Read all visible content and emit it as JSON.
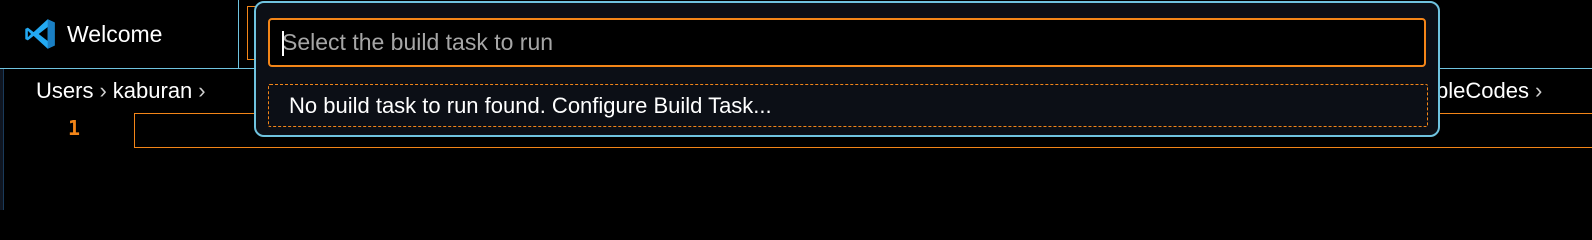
{
  "tabs": [
    {
      "label": "Welcome",
      "icon": "vscode-logo-icon"
    }
  ],
  "breadcrumbs": {
    "items": [
      "Users",
      "kaburan"
    ],
    "trailing": "pleCodes"
  },
  "editor": {
    "line_number": "1"
  },
  "quick_pick": {
    "placeholder": "Select the build task to run",
    "items": [
      {
        "label": "No build task to run found. Configure Build Task..."
      }
    ]
  },
  "colors": {
    "background": "#000000",
    "contrast_border": "#6fc3df",
    "focus_border": "#f38518",
    "brand_blue": "#23a9f2"
  }
}
